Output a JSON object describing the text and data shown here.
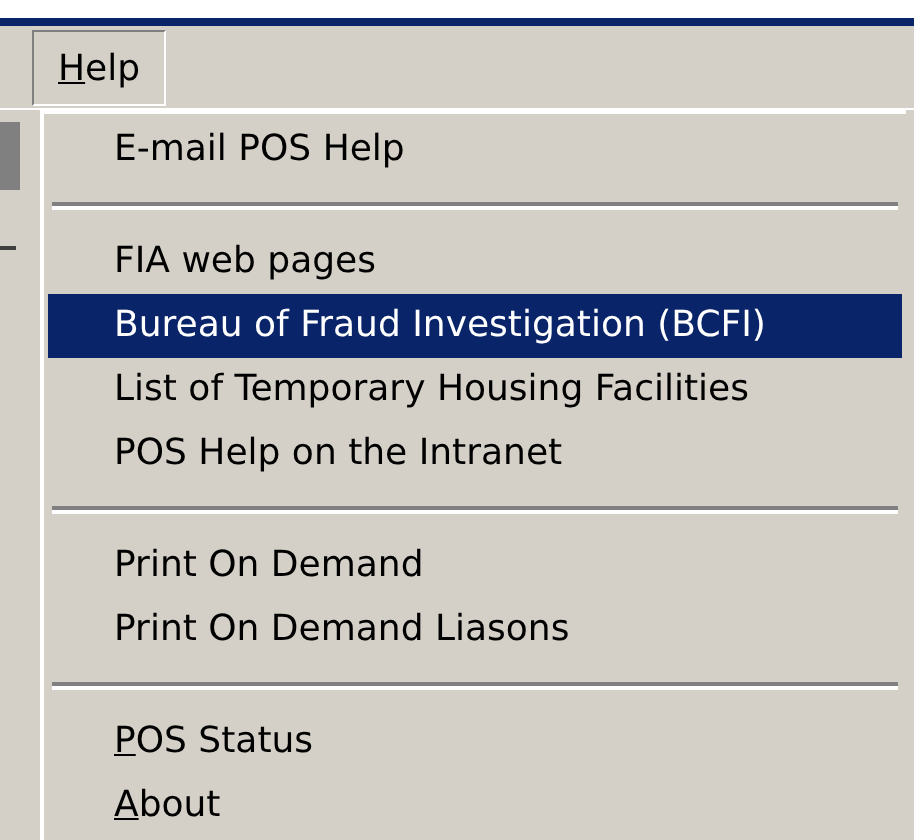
{
  "menu_bar": {
    "menu": {
      "label": "Help",
      "access_key_first_letter": true,
      "open": true
    }
  },
  "dropdown": {
    "groups": [
      [
        {
          "label": "E-mail POS Help",
          "selected": false,
          "access_key_first_letter": false
        }
      ],
      [
        {
          "label": "FIA web pages",
          "selected": false,
          "access_key_first_letter": false
        },
        {
          "label": "Bureau of Fraud Investigation (BCFI)",
          "selected": true,
          "access_key_first_letter": false
        },
        {
          "label": "List of Temporary Housing Facilities",
          "selected": false,
          "access_key_first_letter": false
        },
        {
          "label": "POS Help on the Intranet",
          "selected": false,
          "access_key_first_letter": false
        }
      ],
      [
        {
          "label": "Print On Demand",
          "selected": false,
          "access_key_first_letter": false
        },
        {
          "label": "Print On Demand Liasons",
          "selected": false,
          "access_key_first_letter": false
        }
      ],
      [
        {
          "label": "POS Status",
          "selected": false,
          "access_key_first_letter": true
        },
        {
          "label": "About",
          "selected": false,
          "access_key_first_letter": true
        }
      ]
    ]
  }
}
